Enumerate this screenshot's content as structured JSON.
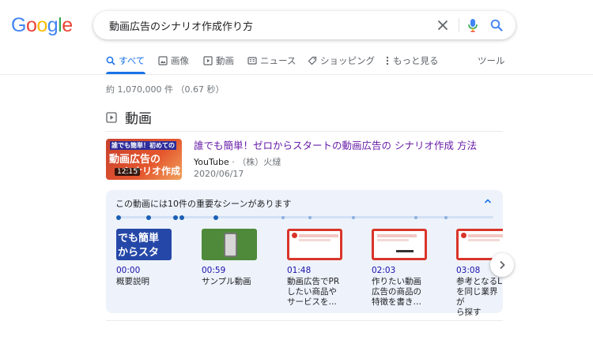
{
  "logo": {
    "letters": [
      "G",
      "o",
      "o",
      "g",
      "l",
      "e"
    ],
    "colors": [
      "#4285f4",
      "#ea4335",
      "#fbbc05",
      "#4285f4",
      "#34a853",
      "#ea4335"
    ]
  },
  "search": {
    "query": "動画広告のシナリオ作成作り方",
    "clear_icon": "close-icon",
    "voice_icon": "mic-icon",
    "search_icon": "search-icon"
  },
  "tabs": [
    {
      "label": "すべて",
      "icon": "search-icon",
      "active": true
    },
    {
      "label": "画像",
      "icon": "image-icon"
    },
    {
      "label": "動画",
      "icon": "play-icon"
    },
    {
      "label": "ニュース",
      "icon": "news-icon"
    },
    {
      "label": "ショッピング",
      "icon": "tag-icon"
    },
    {
      "label": "もっと見る",
      "icon": "more-vert-icon"
    }
  ],
  "tools_label": "ツール",
  "stats": "約 1,070,000 件 （0.67 秒）",
  "videos_section": {
    "title": "動画"
  },
  "video": {
    "title": "誰でも簡単！ゼロからスタートの動画広告の シナリオ作成 方法",
    "source": "YouTube",
    "channel": "（株）火燵",
    "date": "2020/06/17",
    "duration": "12:15",
    "thumb_text": [
      "誰でも簡単！初めての",
      "動画広告の",
      "シナリオ作成"
    ]
  },
  "key_moments": {
    "title": "この動画には10件の重要なシーンがあります",
    "clips": [
      {
        "time": "00:00",
        "desc": [
          "概要説明"
        ],
        "thumb_text": [
          "でも簡単",
          "からスタ"
        ]
      },
      {
        "time": "00:59",
        "desc": [
          "サンプル動画"
        ]
      },
      {
        "time": "01:48",
        "desc": [
          "動画広告でPR",
          "したい商品や",
          "サービスを…"
        ]
      },
      {
        "time": "02:03",
        "desc": [
          "作りたい動画",
          "広告の商品の",
          "特徴を書き…"
        ]
      },
      {
        "time": "03:08",
        "desc": [
          "参考となるL",
          "を同じ業界が",
          "ら探す"
        ]
      }
    ]
  },
  "colors": {
    "link": "#1a0dab",
    "visited": "#681da8",
    "accent": "#1a73e8"
  }
}
